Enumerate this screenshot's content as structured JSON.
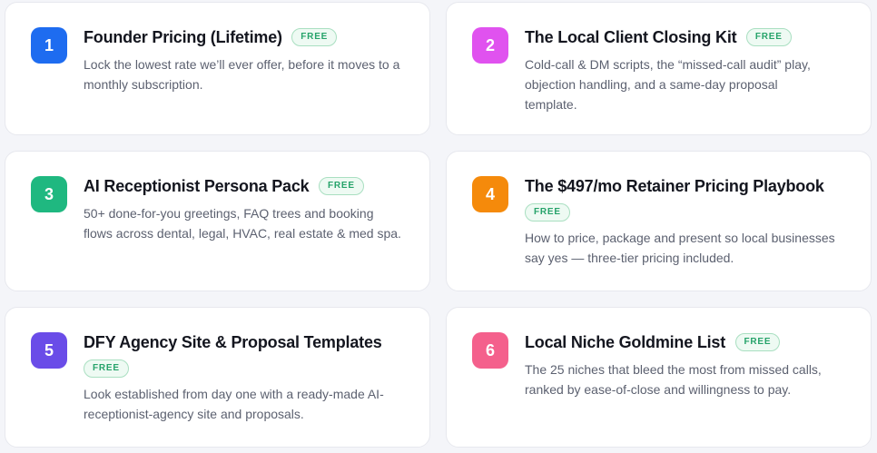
{
  "cards": [
    {
      "number": "1",
      "color": "#1e6cf0",
      "title": "Founder Pricing (Lifetime)",
      "badge": "FREE",
      "description": "Lock the lowest rate we’ll ever offer, before it moves to a monthly subscription."
    },
    {
      "number": "2",
      "color": "#e052ef",
      "title": "The Local Client Closing Kit",
      "badge": "FREE",
      "description": "Cold-call & DM scripts, the “missed-call audit” play, objection handling, and a same-day proposal template."
    },
    {
      "number": "3",
      "color": "#1fb880",
      "title": "AI Receptionist Persona Pack",
      "badge": "FREE",
      "description": "50+ done-for-you greetings, FAQ trees and booking flows across dental, legal, HVAC, real estate & med spa."
    },
    {
      "number": "4",
      "color": "#f58a0b",
      "title": "The $497/mo Retainer Pricing Playbook",
      "badge": "FREE",
      "description": "How to price, package and present so local businesses say yes — three-tier pricing included."
    },
    {
      "number": "5",
      "color": "#6a4ce8",
      "title": "DFY Agency Site & Proposal Templates",
      "badge": "FREE",
      "description": "Look established from day one with a ready-made AI-receptionist-agency site and proposals."
    },
    {
      "number": "6",
      "color": "#f4608c",
      "title": "Local Niche Goldmine List",
      "badge": "FREE",
      "description": "The 25 niches that bleed the most from missed calls, ranked by ease-of-close and willingness to pay."
    }
  ]
}
